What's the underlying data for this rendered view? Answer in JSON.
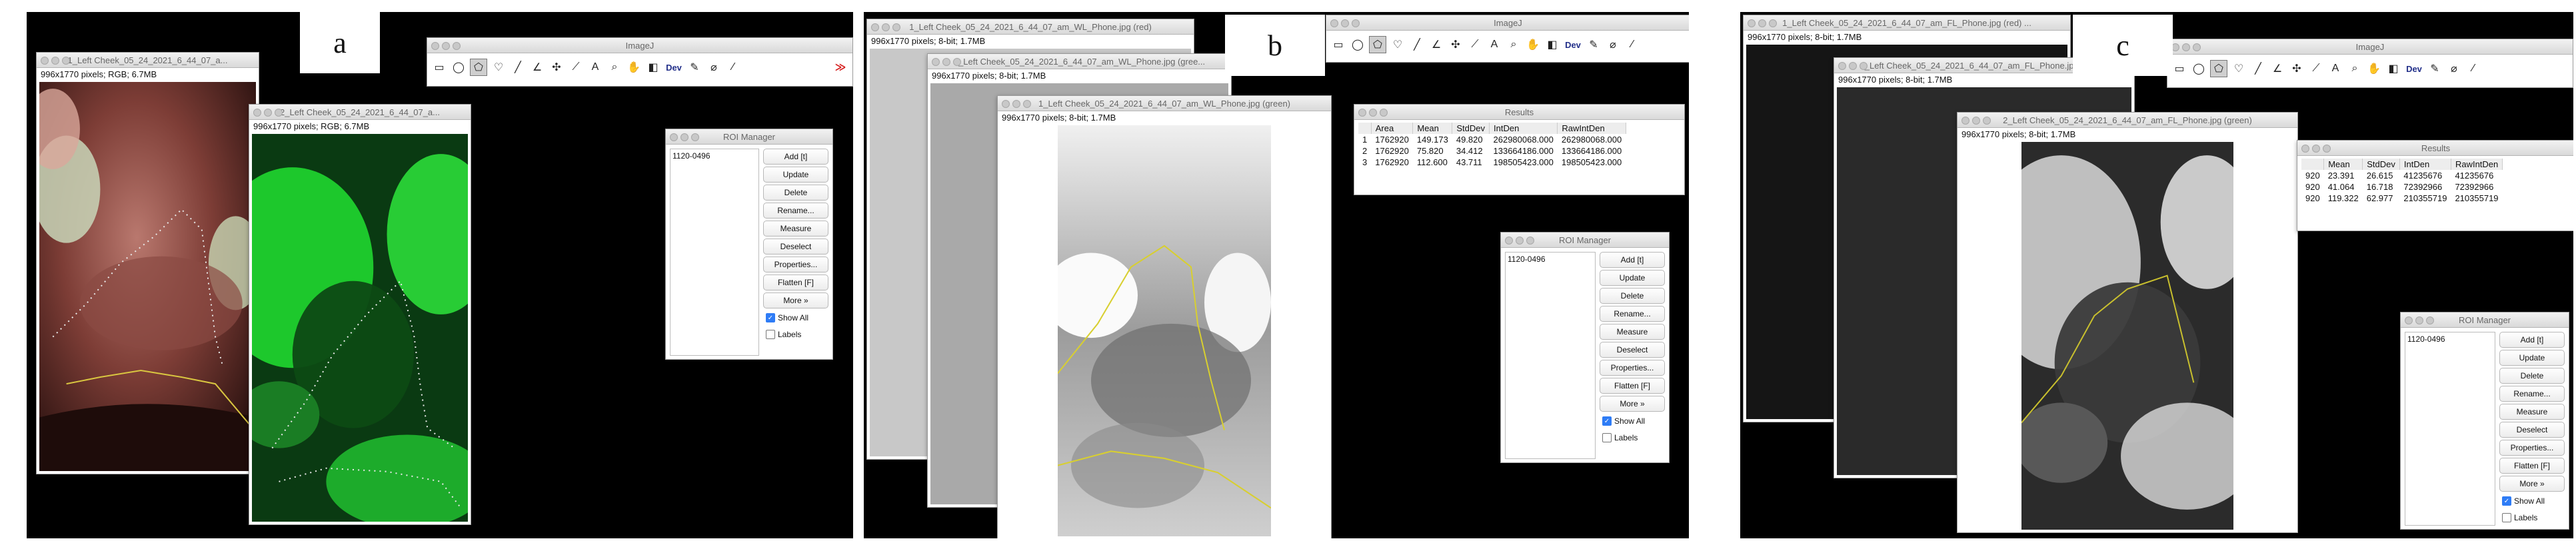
{
  "panel_a": {
    "label": "a",
    "win1": {
      "title": "1_Left Cheek_05_24_2021_6_44_07_a...",
      "info": "996x1770 pixels; RGB; 6.7MB"
    },
    "win2": {
      "title": "2_Left Cheek_05_24_2021_6_44_07_a...",
      "info": "996x1770 pixels; RGB; 6.7MB"
    },
    "imagej_title": "ImageJ",
    "roi": {
      "title": "ROI Manager",
      "list_item": "1120-0496"
    }
  },
  "panel_b": {
    "label": "b",
    "win_red": {
      "title": "1_Left Cheek_05_24_2021_6_44_07_am_WL_Phone.jpg (red)",
      "info": "996x1770 pixels; 8-bit; 1.7MB"
    },
    "win_mid": {
      "title": "1_Left Cheek_05_24_2021_6_44_07_am_WL_Phone.jpg (gree...",
      "info": "996x1770 pixels; 8-bit; 1.7MB"
    },
    "win_green": {
      "title": "1_Left Cheek_05_24_2021_6_44_07_am_WL_Phone.jpg (green)",
      "info": "996x1770 pixels; 8-bit; 1.7MB"
    },
    "imagej_title": "ImageJ",
    "results": {
      "title": "Results",
      "headers": [
        "",
        "Area",
        "Mean",
        "StdDev",
        "IntDen",
        "RawIntDen"
      ],
      "rows": [
        [
          "1",
          "1762920",
          "149.173",
          "49.820",
          "262980068.000",
          "262980068.000"
        ],
        [
          "2",
          "1762920",
          "75.820",
          "34.412",
          "133664186.000",
          "133664186.000"
        ],
        [
          "3",
          "1762920",
          "112.600",
          "43.711",
          "198505423.000",
          "198505423.000"
        ]
      ]
    },
    "roi": {
      "title": "ROI Manager",
      "list_item": "1120-0496"
    }
  },
  "panel_c": {
    "label": "c",
    "win_red": {
      "title": "1_Left Cheek_05_24_2021_6_44_07_am_FL_Phone.jpg (red) ...",
      "info": "996x1770 pixels; 8-bit; 1.7MB"
    },
    "win_mid": {
      "title": "2_Left Cheek_05_24_2021_6_44_07_am_FL_Phone.jpg (gree...",
      "info": "996x1770 pixels; 8-bit; 1.7MB"
    },
    "win_green": {
      "title": "2_Left Cheek_05_24_2021_6_44_07_am_FL_Phone.jpg (green)",
      "info": "996x1770 pixels; 8-bit; 1.7MB"
    },
    "imagej_title": "ImageJ",
    "results": {
      "title": "Results",
      "headers": [
        "",
        "Mean",
        "StdDev",
        "IntDen",
        "RawIntDen"
      ],
      "rows": [
        [
          "920",
          "23.391",
          "26.615",
          "41235676",
          "41235676"
        ],
        [
          "920",
          "41.064",
          "16.718",
          "72392966",
          "72392966"
        ],
        [
          "920",
          "119.322",
          "62.977",
          "210355719",
          "210355719"
        ]
      ]
    },
    "roi": {
      "title": "ROI Manager",
      "list_item": "1120-0496"
    }
  },
  "roi_buttons": [
    "Add [t]",
    "Update",
    "Delete",
    "Rename...",
    "Measure",
    "Deselect",
    "Properties...",
    "Flatten [F]",
    "More »"
  ],
  "roi_checks": {
    "show_all": "Show All",
    "labels": "Labels"
  },
  "toolbar_dev": "Dev",
  "toolbar_arrow": "≫",
  "toolbar_icons": [
    "rectangle-tool-icon",
    "oval-tool-icon",
    "polygon-tool-icon",
    "freehand-tool-icon",
    "line-tool-icon",
    "angle-tool-icon",
    "point-tool-icon",
    "wand-tool-icon",
    "text-tool-icon",
    "magnifier-tool-icon",
    "hand-tool-icon",
    "color-picker-icon",
    "dev-icon",
    "pencil-icon",
    "dropper-icon",
    "brush-icon",
    "more-tools-icon"
  ]
}
